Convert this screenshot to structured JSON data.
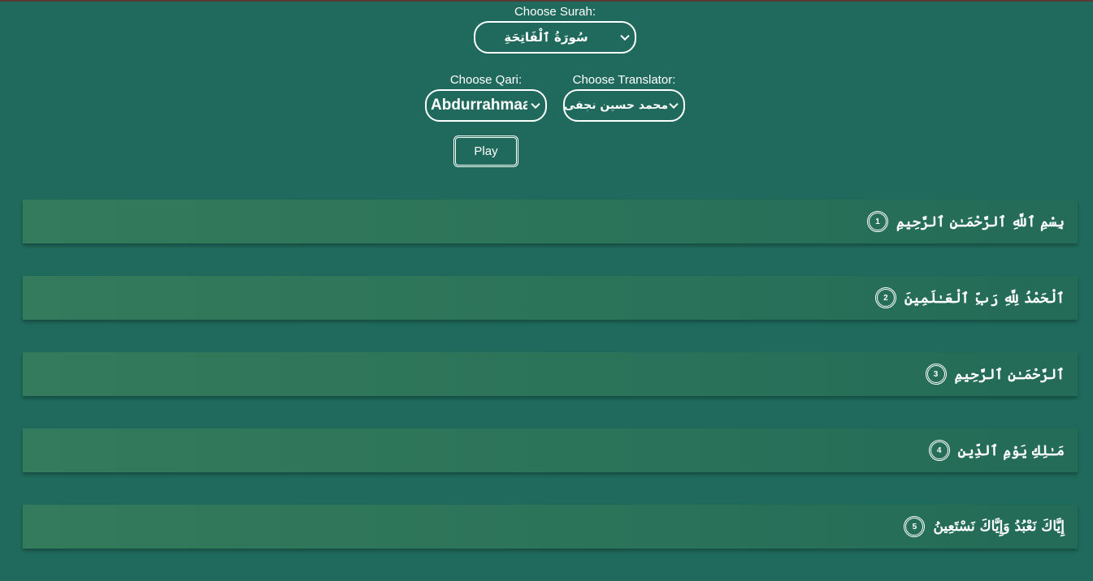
{
  "controls": {
    "surah": {
      "label": "Choose Surah:",
      "selected": "سُورَةُ ٱلْفَاتِحَةِ"
    },
    "qari": {
      "label": "Choose Qari:",
      "selected": "Abdurrahmaan As-Sudais"
    },
    "translator": {
      "label": "Choose Translator:",
      "selected": "محمد حسين نجفى"
    },
    "play_label": "Play"
  },
  "verses": [
    {
      "number": "1",
      "text": "بِسْمِ ٱللَّهِ ٱلرَّحْمَـٰنِ ٱلرَّحِيمِ"
    },
    {
      "number": "2",
      "text": "ٱلْحَمْدُ لِلَّهِ رَبِّ ٱلْعَـٰلَمِينَ"
    },
    {
      "number": "3",
      "text": "ٱلرَّحْمَـٰنِ ٱلرَّحِيمِ"
    },
    {
      "number": "4",
      "text": "مَـٰلِكِ يَوْمِ ٱلدِّينِ"
    },
    {
      "number": "5",
      "text": "إِيَّاكَ نَعْبُدُ وَإِيَّاكَ نَسْتَعِينُ"
    }
  ],
  "colors": {
    "background": "#1f6a5c",
    "verse_gradient_start": "#347a5c",
    "verse_gradient_end": "#246b58",
    "text": "#ffffff"
  },
  "icons": {
    "dropdown": "chevron-down-icon"
  }
}
